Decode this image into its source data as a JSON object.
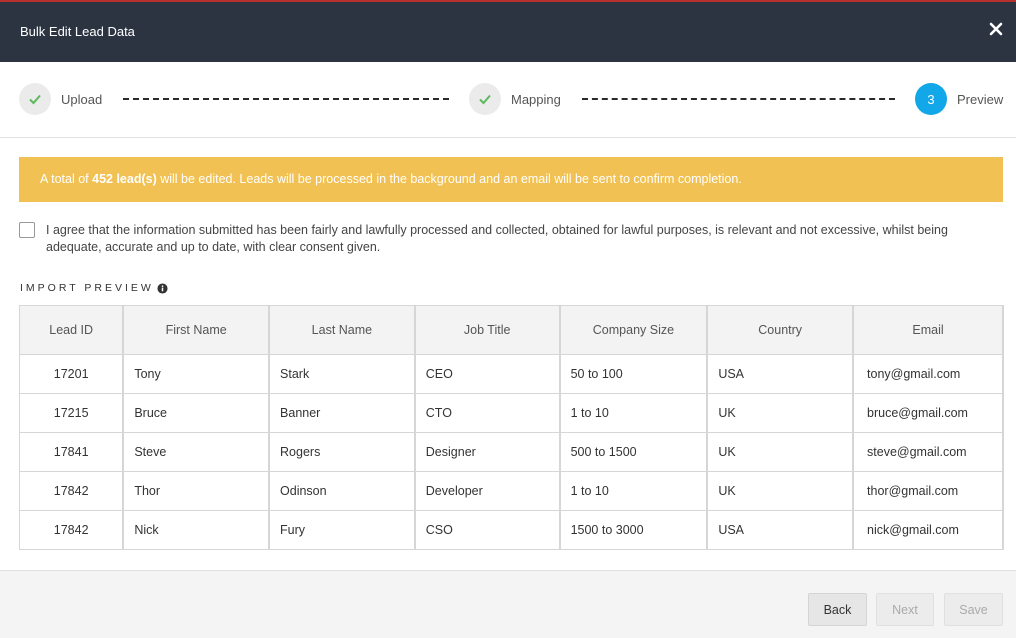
{
  "header": {
    "title": "Bulk Edit Lead Data",
    "close_icon": "close-icon"
  },
  "stepper": {
    "steps": [
      {
        "label": "Upload",
        "state": "done",
        "icon": "check-icon"
      },
      {
        "label": "Mapping",
        "state": "done",
        "icon": "check-icon"
      },
      {
        "label": "Preview",
        "state": "active",
        "number": "3"
      }
    ],
    "accent_color": "#11a7e8",
    "check_color": "#5cb85c"
  },
  "banner": {
    "prefix": "A total of ",
    "count": "452 lead(s)",
    "suffix": " will be edited. Leads will be processed in the background and an email will be sent to confirm completion.",
    "color": "#f1c153"
  },
  "consent": {
    "checked": false,
    "text": "I agree that the information submitted has been fairly and lawfully processed and collected, obtained for lawful purposes, is relevant and not excessive, whilst being adequate, accurate and up to date, with clear consent given."
  },
  "preview": {
    "title": "IMPORT PREVIEW",
    "info_icon": "info-icon",
    "columns": [
      "Lead ID",
      "First Name",
      "Last Name",
      "Job Title",
      "Company Size",
      "Country",
      "Email"
    ],
    "rows": [
      [
        "17201",
        "Tony",
        "Stark",
        "CEO",
        "50 to 100",
        "USA",
        "tony@gmail.com"
      ],
      [
        "17215",
        "Bruce",
        "Banner",
        "CTO",
        "1 to 10",
        "UK",
        "bruce@gmail.com"
      ],
      [
        "17841",
        "Steve",
        "Rogers",
        "Designer",
        "500 to 1500",
        "UK",
        "steve@gmail.com"
      ],
      [
        "17842",
        "Thor",
        "Odinson",
        "Developer",
        "1 to 10",
        "UK",
        "thor@gmail.com"
      ],
      [
        "17842",
        "Nick",
        "Fury",
        "CSO",
        "1500 to 3000",
        "USA",
        "nick@gmail.com"
      ]
    ]
  },
  "footer": {
    "back_label": "Back",
    "next_label": "Next",
    "save_label": "Save"
  }
}
